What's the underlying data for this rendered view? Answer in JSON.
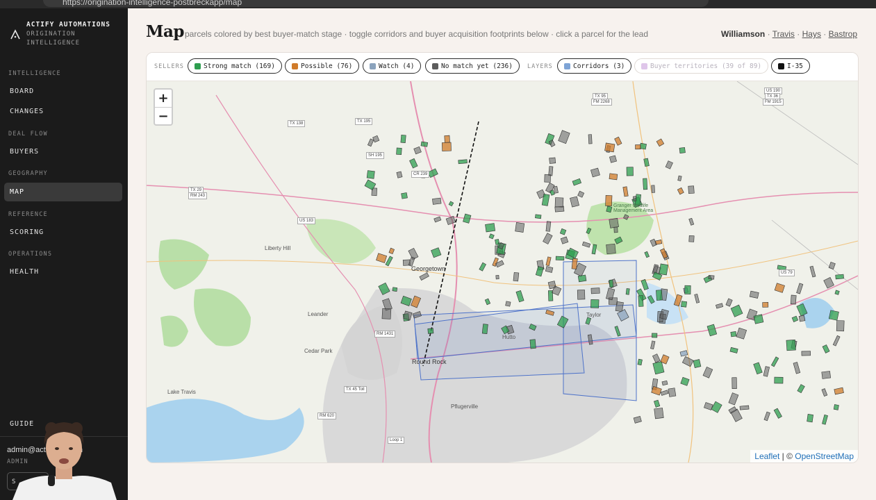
{
  "browser": {
    "url": "https://origination-intelligence-postbreckapp/map"
  },
  "brand": {
    "line1": "ACTIFY AUTOMATIONS",
    "line2": "ORIGINATION",
    "line3": "INTELLIGENCE"
  },
  "nav": {
    "intelligence_label": "INTELLIGENCE",
    "board": "BOARD",
    "changes": "CHANGES",
    "dealflow_label": "DEAL FLOW",
    "buyers": "BUYERS",
    "geography_label": "GEOGRAPHY",
    "map": "MAP",
    "reference_label": "REFERENCE",
    "scoring": "SCORING",
    "operations_label": "OPERATIONS",
    "health": "HEALTH",
    "guide": "GUIDE"
  },
  "user": {
    "email": "admin@acti...ons.com",
    "role": "ADMIN",
    "signout": "S"
  },
  "page": {
    "title": "Map",
    "subtitle": "parcels colored by best buyer-match stage · toggle corridors and buyer acquisition footprints below · click a parcel for the lead"
  },
  "regions": {
    "current": "Williamson",
    "sep": "·",
    "links": [
      "Travis",
      "Hays",
      "Bastrop"
    ]
  },
  "toolbar": {
    "sellers_label": "SELLERS",
    "layers_label": "LAYERS",
    "sellers": [
      {
        "label": "Strong match (169)",
        "color": "#2e9e4f"
      },
      {
        "label": "Possible (76)",
        "color": "#d07b2a"
      },
      {
        "label": "Watch (4)",
        "color": "#8ba3bd"
      },
      {
        "label": "No match yet (236)",
        "color": "#5c5c5c"
      }
    ],
    "layers": [
      {
        "label": "Corridors (3)",
        "color": "#7ea4d6",
        "on": true
      },
      {
        "label": "Buyer territories (39 of 89)",
        "color": "#c9a0dc",
        "on": false
      },
      {
        "label": "I-35",
        "color": "#111111",
        "on": true
      }
    ]
  },
  "map": {
    "zoom_in": "+",
    "zoom_out": "−",
    "attribution": {
      "leaflet": "Leaflet",
      "sep": " | © ",
      "osm": "OpenStreetMap"
    },
    "places": {
      "georgetown": "Georgetown",
      "round_rock": "Round Rock",
      "hutto": "Hutto",
      "taylor": "Taylor",
      "leander": "Leander",
      "cedar_park": "Cedar Park",
      "liberty_hill": "Liberty Hill",
      "pflugerville": "Pflugerville",
      "lake_travis": "Lake Travis",
      "granger": "Granger Wildlife Management Area"
    },
    "shields": {
      "tx138": "TX 138",
      "tx195": "TX 195",
      "sh195": "SH 195",
      "cr239": "CR 239",
      "tx29": "TX 29",
      "rm243": "RM 243",
      "us183": "US 183",
      "tx95": "TX 95",
      "fm2268": "FM 2268",
      "us190": "US 190",
      "tx36": "TX 36",
      "fm1915": "FM 1915",
      "us79": "US 79",
      "tx45": "TX 45 Toll",
      "rm620": "RM 620",
      "loop1": "Loop 1",
      "rm1431": "RM 1431"
    },
    "colors": {
      "strong": "#2e9e4f",
      "possible": "#d07b2a",
      "watch": "#8ba3bd",
      "none": "#5c5c5c",
      "corridor": "#4d72c9"
    }
  }
}
